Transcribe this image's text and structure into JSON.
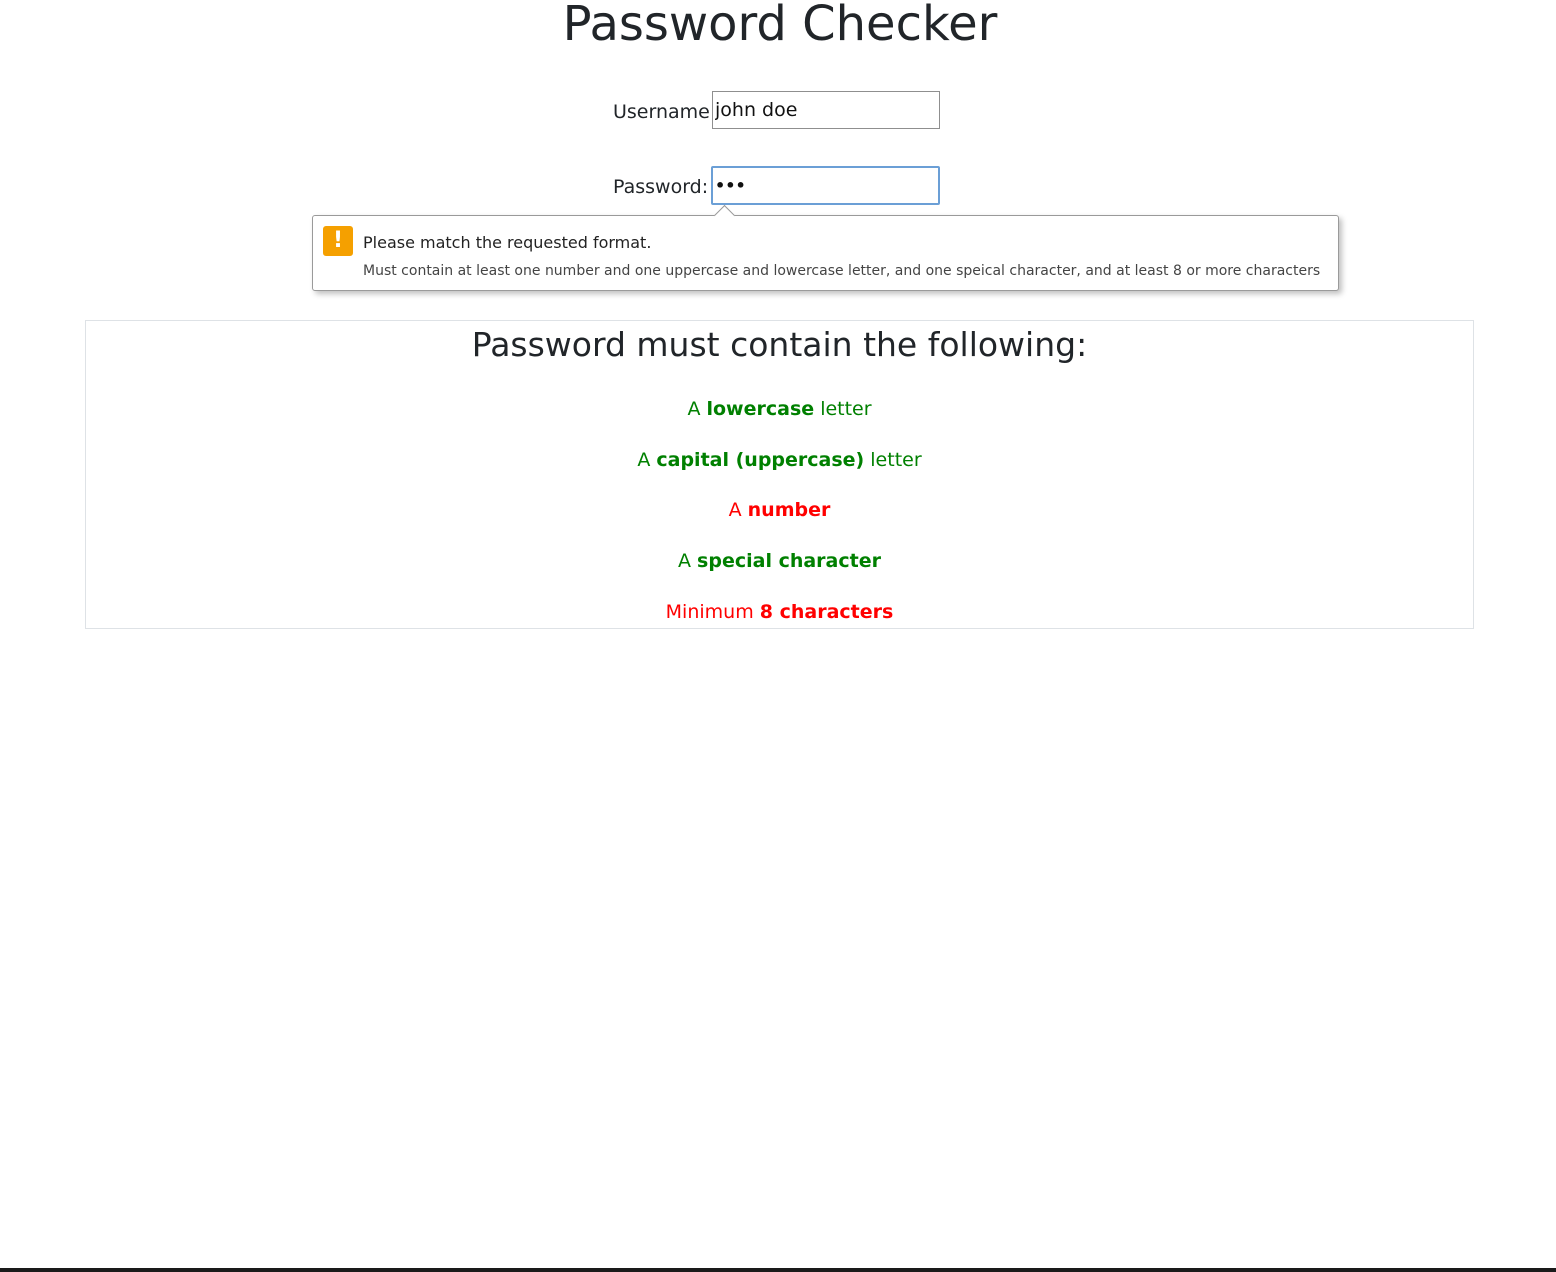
{
  "page_title": "Password Checker",
  "form": {
    "username_label": "Username:",
    "username_value": "john doe",
    "password_label": "Password:",
    "password_mask": "•••"
  },
  "validation_tooltip": {
    "icon": "warning-icon",
    "icon_glyph": "!",
    "title": "Please match the requested format.",
    "detail": "Must contain at least one number and one uppercase and lowercase letter, and one speical character, and at least 8 or more characters",
    "icon_color": "#f5a000"
  },
  "requirements": {
    "heading": "Password must contain the following:",
    "items": [
      {
        "prefix": "A",
        "bold": "lowercase",
        "suffix": "letter",
        "status": "valid"
      },
      {
        "prefix": "A",
        "bold": "capital (uppercase)",
        "suffix": "letter",
        "status": "valid"
      },
      {
        "prefix": "A",
        "bold": "number",
        "suffix": "",
        "status": "invalid"
      },
      {
        "prefix": "A",
        "bold": "special character",
        "suffix": "",
        "status": "valid"
      },
      {
        "prefix": "Minimum",
        "bold": "8 characters",
        "suffix": "",
        "status": "invalid"
      }
    ]
  },
  "colors": {
    "valid": "#008000",
    "invalid": "#ff0000",
    "focus_border": "#6b9fd6"
  }
}
